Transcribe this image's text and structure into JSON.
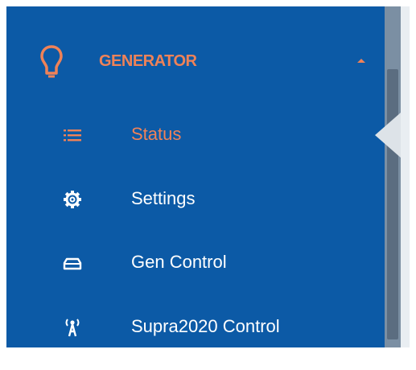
{
  "sidebar": {
    "section": {
      "label": "GENERATOR",
      "icon": "lightbulb-icon",
      "expanded": true
    },
    "items": [
      {
        "label": "Status",
        "icon": "list-icon",
        "active": true
      },
      {
        "label": "Settings",
        "icon": "gear-icon",
        "active": false
      },
      {
        "label": "Gen Control",
        "icon": "generator-icon",
        "active": false
      },
      {
        "label": "Supra2020 Control",
        "icon": "antenna-icon",
        "active": false
      }
    ]
  },
  "colors": {
    "sidebar_bg": "#0c5aa6",
    "accent": "#ef8258",
    "text": "#ffffff"
  }
}
